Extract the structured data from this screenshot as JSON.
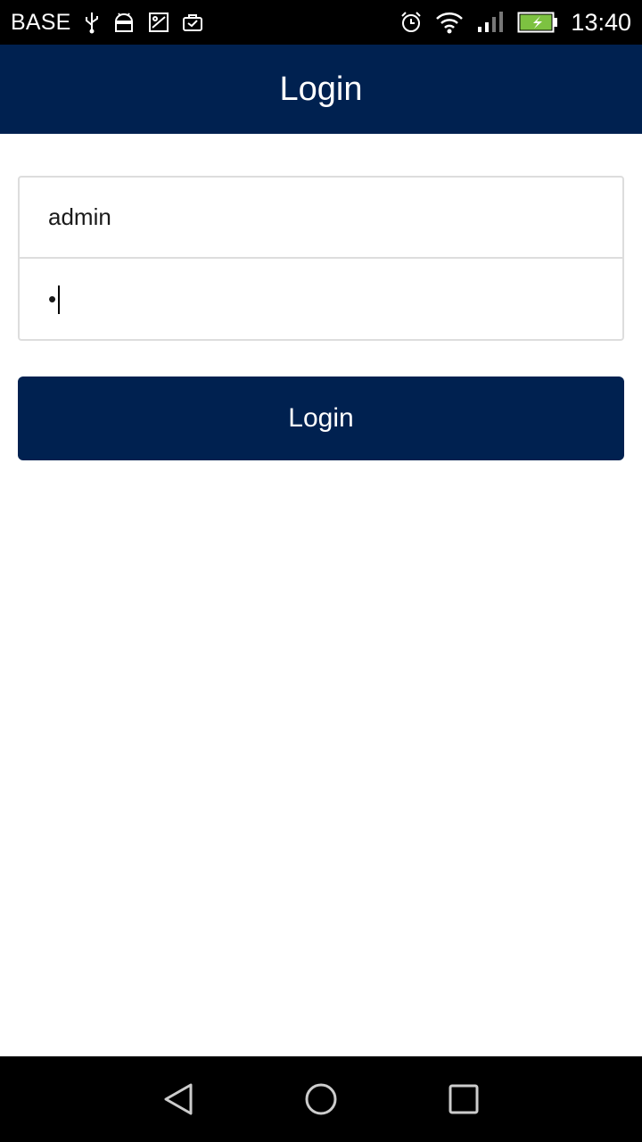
{
  "status_bar": {
    "carrier": "BASE",
    "time": "13:40",
    "icons": [
      "usb-icon",
      "android-icon",
      "image-icon",
      "briefcase-icon",
      "alarm-icon",
      "wifi-icon",
      "signal-icon",
      "battery-charging-icon"
    ]
  },
  "app_bar": {
    "title": "Login"
  },
  "form": {
    "username_value": "admin",
    "password_value": "•"
  },
  "login_button": {
    "label": "Login"
  },
  "nav_bar": {
    "icons": [
      "back-icon",
      "home-icon",
      "recents-icon"
    ]
  },
  "colors": {
    "primary": "#002150",
    "status_bar": "#000000",
    "battery": "#7dc241"
  }
}
